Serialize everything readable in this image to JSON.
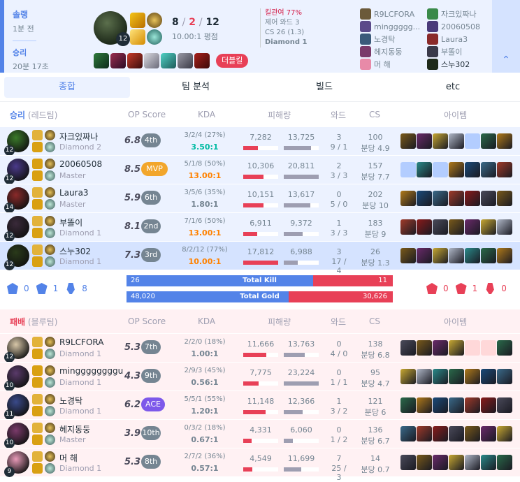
{
  "summary": {
    "queue": "솔랭",
    "ago": "1분 전",
    "result": "승리",
    "duration": "20분 17초",
    "champ_level": "12",
    "kills": "8",
    "deaths": "2",
    "assists": "12",
    "slash": "/",
    "kda_ratio": "10.00:1 평점",
    "kill_participation": "킬관여 77%",
    "control_ward": "제어 와드 3",
    "cs": "CS 26 (1.3)",
    "tier": "Diamond 1",
    "multikill": "더블킬",
    "players_left": [
      "R9LCFORA",
      "minggggg...",
      "노경탁",
      "헤지동둥",
      "머 해"
    ],
    "players_right": [
      "자크있짜나",
      "20060508",
      "Laura3",
      "부똘이",
      "스누302"
    ]
  },
  "tabs": [
    "종합",
    "팀 분석",
    "빌드",
    "etc"
  ],
  "headers": {
    "op": "OP Score",
    "kda": "KDA",
    "damage": "피해량",
    "ward": "와드",
    "cs": "CS",
    "items": "아이템"
  },
  "team_win": {
    "result": "승리",
    "side": "(레드팀)"
  },
  "team_lose": {
    "result": "패배",
    "side": "(블루팀)"
  },
  "win_players": [
    {
      "name": "자크있짜나",
      "tier": "Diamond 2",
      "level": "12",
      "op": "6.8",
      "rank": "4th",
      "kda": "3/2/4 (27%)",
      "ratio": "3.50:1",
      "dealt": "7,282",
      "taken": "13,725",
      "dealt_pct": 0.41,
      "taken_pct": 0.77,
      "ward": "3",
      "ward2": "9 / 1",
      "cs": "100",
      "cspm": "분당 4.9"
    },
    {
      "name": "20060508",
      "tier": "Master",
      "level": "12",
      "op": "8.5",
      "rank": "MVP",
      "kda": "5/1/8 (50%)",
      "ratio": "13.00:1",
      "dealt": "10,306",
      "taken": "20,811",
      "dealt_pct": 0.58,
      "taken_pct": 1.0,
      "ward": "2",
      "ward2": "3 / 3",
      "cs": "157",
      "cspm": "분당 7.7"
    },
    {
      "name": "Laura3",
      "tier": "Master",
      "level": "14",
      "op": "5.9",
      "rank": "6th",
      "kda": "3/5/6 (35%)",
      "ratio": "1.80:1",
      "dealt": "10,151",
      "taken": "13,617",
      "dealt_pct": 0.57,
      "taken_pct": 0.76,
      "ward": "0",
      "ward2": "5 / 0",
      "cs": "202",
      "cspm": "분당 10"
    },
    {
      "name": "부똘이",
      "tier": "Diamond 1",
      "level": "12",
      "op": "8.1",
      "rank": "2nd",
      "kda": "7/1/6 (50%)",
      "ratio": "13.00:1",
      "dealt": "6,911",
      "taken": "9,372",
      "dealt_pct": 0.39,
      "taken_pct": 0.53,
      "ward": "1",
      "ward2": "3 / 3",
      "cs": "183",
      "cspm": "분당 9"
    },
    {
      "name": "스누302",
      "tier": "Diamond 1",
      "level": "12",
      "op": "7.3",
      "rank": "3rd",
      "kda": "8/2/12 (77%)",
      "ratio": "10.00:1",
      "dealt": "17,812",
      "taken": "6,988",
      "dealt_pct": 1.0,
      "taken_pct": 0.39,
      "ward": "3",
      "ward2": "17 / 4",
      "cs": "26",
      "cspm": "분당 1.3"
    }
  ],
  "lose_players": [
    {
      "name": "R9LCFORA",
      "tier": "Diamond 1",
      "level": "12",
      "op": "5.3",
      "rank": "7th",
      "kda": "2/2/0 (18%)",
      "ratio": "1.00:1",
      "dealt": "11,666",
      "taken": "13,763",
      "dealt_pct": 0.65,
      "taken_pct": 0.59,
      "ward": "0",
      "ward2": "4 / 0",
      "cs": "138",
      "cspm": "분당 6.8"
    },
    {
      "name": "minggggggggu",
      "tier": "Diamond 1",
      "level": "10",
      "op": "4.3",
      "rank": "9th",
      "kda": "2/9/3 (45%)",
      "ratio": "0.56:1",
      "dealt": "7,775",
      "taken": "23,224",
      "dealt_pct": 0.44,
      "taken_pct": 1.0,
      "ward": "0",
      "ward2": "1 / 1",
      "cs": "95",
      "cspm": "분당 4.7"
    },
    {
      "name": "노경탁",
      "tier": "Diamond 1",
      "level": "11",
      "op": "6.2",
      "rank": "ACE",
      "kda": "5/5/1 (55%)",
      "ratio": "1.20:1",
      "dealt": "11,148",
      "taken": "12,366",
      "dealt_pct": 0.63,
      "taken_pct": 0.53,
      "ward": "1",
      "ward2": "3 / 2",
      "cs": "121",
      "cspm": "분당 6"
    },
    {
      "name": "헤지동둥",
      "tier": "Master",
      "level": "10",
      "op": "3.9",
      "rank": "10th",
      "kda": "0/3/2 (18%)",
      "ratio": "0.67:1",
      "dealt": "4,331",
      "taken": "6,060",
      "dealt_pct": 0.24,
      "taken_pct": 0.26,
      "ward": "0",
      "ward2": "1 / 2",
      "cs": "136",
      "cspm": "분당 6.7"
    },
    {
      "name": "머 해",
      "tier": "Diamond 1",
      "level": "9",
      "op": "5.3",
      "rank": "8th",
      "kda": "2/7/2 (36%)",
      "ratio": "0.57:1",
      "dealt": "4,549",
      "taken": "11,699",
      "dealt_pct": 0.26,
      "taken_pct": 0.5,
      "ward": "7",
      "ward2": "25 / 3",
      "cs": "14",
      "cspm": "분당 0.7"
    }
  ],
  "totals": {
    "win_objectives": [
      "0",
      "1",
      "8"
    ],
    "lose_objectives": [
      "0",
      "1",
      "0"
    ],
    "kill_label": "Total Kill",
    "kill_win": "26",
    "kill_lose": "11",
    "kill_win_share": 0.7,
    "gold_label": "Total Gold",
    "gold_win": "48,020",
    "gold_lose": "30,626",
    "gold_win_share": 0.61
  },
  "colors": {
    "win": "#5383e8",
    "lose": "#e84057",
    "win_bg": "#ecf2ff",
    "lose_bg": "#fff1f3",
    "dealt": "#e84057",
    "taken": "#9e9eb1"
  }
}
